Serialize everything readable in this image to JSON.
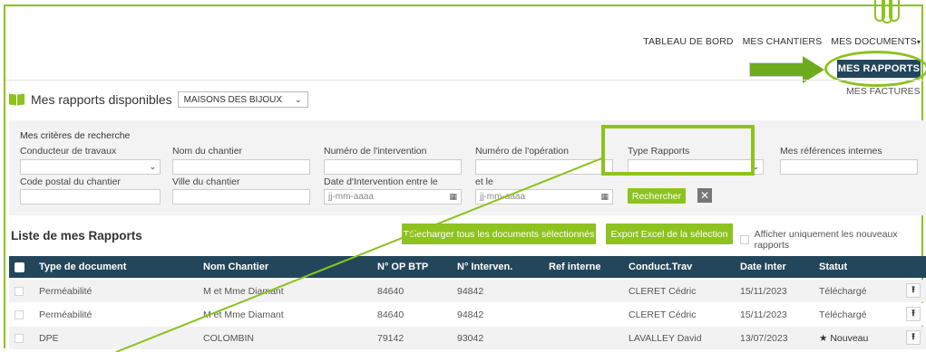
{
  "nav": {
    "dashboard": "TABLEAU DE BORD",
    "sites": "MES CHANTIERS",
    "documents": "MES DOCUMENTS",
    "documents_caret": "▾",
    "reports": "MES RAPPORTS",
    "invoices": "MES FACTURES"
  },
  "header": {
    "title": "Mes rapports disponibles",
    "company_select": "MAISONS DES BIJOUX",
    "select_caret": "⌄"
  },
  "criteria": {
    "heading": "Mes critères de recherche",
    "works_manager": {
      "label": "Conducteur de travaux",
      "value": ""
    },
    "site_name": {
      "label": "Nom du chantier",
      "value": ""
    },
    "intervention_number": {
      "label": "Numéro de l'intervention",
      "value": ""
    },
    "operation_number": {
      "label": "Numéro de l'opération",
      "value": ""
    },
    "report_type": {
      "label": "Type Rapports",
      "value": ""
    },
    "internal_refs": {
      "label": "Mes références internes",
      "value": ""
    },
    "postal_code": {
      "label": "Code postal du chantier",
      "value": ""
    },
    "city": {
      "label": "Ville du chantier",
      "value": ""
    },
    "date_from": {
      "label": "Date d'Intervention entre le",
      "placeholder": "jj-mm-aaaa"
    },
    "date_to": {
      "label": "et le",
      "placeholder": "jj-mm-aaaa"
    },
    "search_button": "Rechercher",
    "clear_button": "✕"
  },
  "list": {
    "title": "Liste de mes Rapports",
    "download_button": "Télécharger tous les documents sélectionnés",
    "export_button": "Export Excel de la sélection",
    "only_new_label": "Afficher uniquement les nouveaux rapports",
    "columns": [
      "Type de document",
      "Nom Chantier",
      "N° OP BTP",
      "N° Interven.",
      "Ref interne",
      "Conduct.Trav",
      "Date Inter",
      "Statut"
    ],
    "rows": [
      {
        "type": "Perméabilité",
        "site": "M et Mme Diamant",
        "op": "84640",
        "interv": "94842",
        "ref": "",
        "manager": "CLERET Cédric",
        "date": "15/11/2023",
        "status": "Téléchargé"
      },
      {
        "type": "Perméabilité",
        "site": "M et Mme Diamant",
        "op": "84640",
        "interv": "94842",
        "ref": "",
        "manager": "CLERET Cédric",
        "date": "15/11/2023",
        "status": "Téléchargé"
      },
      {
        "type": "DPE",
        "site": "COLOMBIN",
        "op": "79142",
        "interv": "93042",
        "ref": "",
        "manager": "LAVALLEY David",
        "date": "13/07/2023",
        "status": "★ Nouveau"
      }
    ]
  },
  "colors": {
    "accent_green": "#8dc21f",
    "navy": "#23465b"
  },
  "icons": {
    "book": "book-icon",
    "upload": "upload-icon",
    "calendar": "calendar-icon",
    "paperclip": "paperclip-icon"
  }
}
